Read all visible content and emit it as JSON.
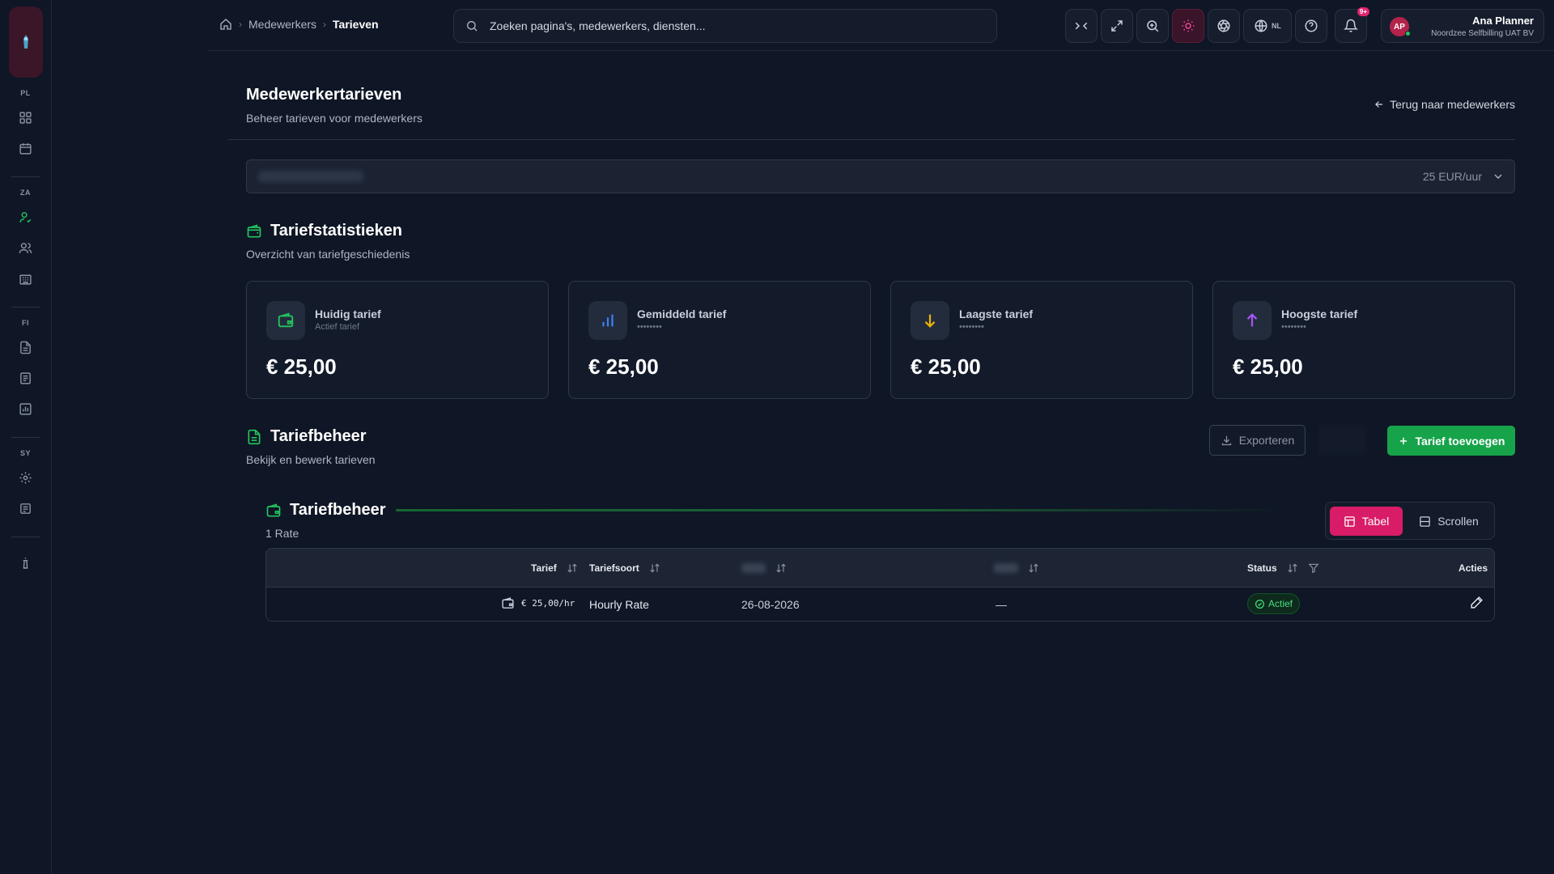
{
  "sidebar": {
    "sections": [
      "PL",
      "ZA",
      "FI",
      "SY"
    ]
  },
  "topbar": {
    "breadcrumb": [
      "Medewerkers",
      "Tarieven"
    ],
    "search_placeholder": "Zoeken pagina's, medewerkers, diensten...",
    "language": "NL",
    "notifications_badge": "9+",
    "user": {
      "initials": "AP",
      "name": "Ana Planner",
      "org": "Noordzee Selfbilling UAT BV"
    }
  },
  "page": {
    "title": "Medewerkertarieven",
    "subtitle": "Beheer tarieven voor medewerkers",
    "back_link": "Terug naar medewerkers"
  },
  "rate_select": {
    "value": "25 EUR/uur"
  },
  "stats": {
    "title": "Tariefstatistieken",
    "subtitle": "Overzicht van tariefgeschiedenis",
    "cards": [
      {
        "label": "Huidig tarief",
        "sub": "Actief tarief",
        "value": "€ 25,00",
        "icon": "wallet-icon",
        "color": "#22c55e"
      },
      {
        "label": "Gemiddeld tarief",
        "sub": "••••••••",
        "value": "€ 25,00",
        "icon": "bar-chart-icon",
        "color": "#3b82f6"
      },
      {
        "label": "Laagste tarief",
        "sub": "••••••••",
        "value": "€ 25,00",
        "icon": "arrow-down-icon",
        "color": "#eab308"
      },
      {
        "label": "Hoogste tarief",
        "sub": "••••••••",
        "value": "€ 25,00",
        "icon": "arrow-up-icon",
        "color": "#a855f7"
      }
    ]
  },
  "management": {
    "title": "Tariefbeheer",
    "subtitle": "Bekijk en bewerk tarieven",
    "export_label": "Exporteren",
    "add_label": "Tarief toevoegen"
  },
  "table": {
    "title": "Tariefbeheer",
    "count": "1 Rate",
    "view_table": "Tabel",
    "view_scroll": "Scrollen",
    "headers": {
      "rate": "Tarief",
      "type": "Tariefsoort",
      "status": "Status",
      "actions": "Acties"
    },
    "rows": [
      {
        "rate": "€ 25,00/hr",
        "type": "Hourly Rate",
        "start": "26-08-2026",
        "end": "—",
        "status": "Actief"
      }
    ]
  }
}
